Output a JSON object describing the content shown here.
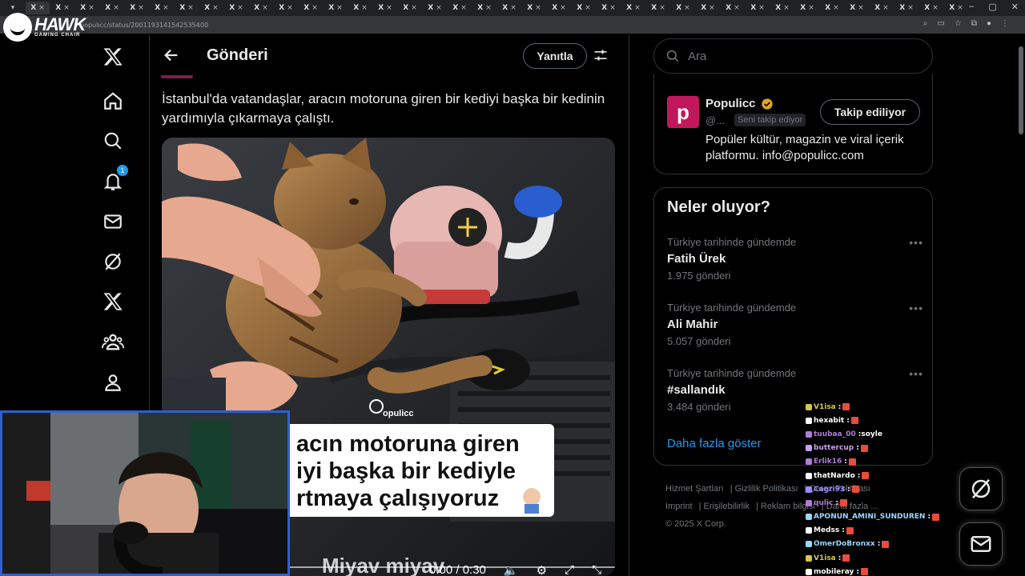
{
  "browser": {
    "tab_label": "X",
    "url": "populıcc/status/2001193141542535400",
    "tab_count": 38
  },
  "overlay_logo": {
    "brand": "HAWK",
    "tagline": "GAMING CHAIR"
  },
  "nav": {
    "items": [
      "x-logo",
      "home",
      "search",
      "notifications",
      "messages",
      "grok",
      "premium",
      "communities",
      "profile"
    ],
    "notification_badge": "1"
  },
  "header": {
    "title": "Gönderi",
    "reply_label": "Yanıtla"
  },
  "tweet": {
    "text": "İstanbul'da vatandaşlar, aracın motoruna giren bir kediyi başka bir kedinin yardımıyla çıkarmaya çalıştı."
  },
  "media": {
    "watermark": "opulicc",
    "caption_line1": "acın motoruna giren",
    "caption_line2": "iyi başka bir kediyle",
    "caption_line3": "rtmaya çalışıyoruz",
    "bottom_text": "Miyav miyav",
    "time": "0:00 / 0:30"
  },
  "search": {
    "placeholder": "Ara"
  },
  "profile_card": {
    "name": "Populicc",
    "handle": "@...",
    "follows_you": "Seni takip ediyor",
    "follow_label": "Takip ediliyor",
    "bio": "Popüler kültür, magazin ve viral içerik platformu. info@populicc.com"
  },
  "trends": {
    "title": "Neler oluyor?",
    "items": [
      {
        "context": "Türkiye tarihinde gündemde",
        "name": "Fatih Ürek",
        "count": "1.975 gönderi"
      },
      {
        "context": "Türkiye tarihinde gündemde",
        "name": "Ali Mahir",
        "count": "5.057 gönderi"
      },
      {
        "context": "Türkiye tarihinde gündemde",
        "name": "#sallandık",
        "count": "3.484 gönderi"
      }
    ],
    "show_more": "Daha fazla göster"
  },
  "footer": {
    "links": [
      "Hizmet Şartları",
      "Gizlilik Politikası",
      "Çerez Politikası",
      "Imprint",
      "Erişilebilirlik",
      "Reklam bilgisi",
      "Daha fazla ..."
    ],
    "copyright": "© 2025 X Corp."
  },
  "chat": [
    {
      "user": "V1isa",
      "msg": "",
      "color": "#d4c84a"
    },
    {
      "user": "hexabit",
      "msg": "",
      "color": "#ffffff"
    },
    {
      "user": "tuubaa_00",
      "msg": "soyle",
      "color": "#b07cd8"
    },
    {
      "user": "buttercup",
      "msg": "",
      "color": "#c8a0f0"
    },
    {
      "user": "Erlik16",
      "msg": "",
      "color": "#b07cd8"
    },
    {
      "user": "thatNardo",
      "msg": "",
      "color": "#ffffff"
    },
    {
      "user": "Cagri93",
      "msg": "",
      "color": "#9a8cff"
    },
    {
      "user": "qulic",
      "msg": "",
      "color": "#b07cd8"
    },
    {
      "user": "APONUN_AMINI_SUNDUREN",
      "msg": "",
      "color": "#9ad8ff"
    },
    {
      "user": "Medss",
      "msg": "",
      "color": "#ffffff"
    },
    {
      "user": "OmerDoBronxx",
      "msg": "",
      "color": "#9ad8ff"
    },
    {
      "user": "V1isa",
      "msg": "",
      "color": "#d4c84a"
    },
    {
      "user": "mobileray",
      "msg": "",
      "color": "#ffffff"
    }
  ],
  "colors": {
    "accent": "#1d9bf0",
    "border": "#2f3336",
    "muted": "#71767b",
    "text": "#e7e9ea",
    "webcam_border": "#2f5fd0"
  }
}
